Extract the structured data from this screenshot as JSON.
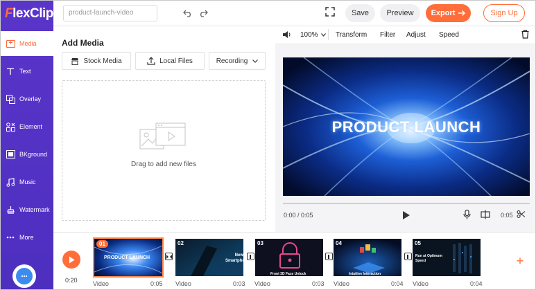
{
  "brand": {
    "logo_first": "F",
    "logo_rest": "lexClip",
    "accent": "#ff6e3a",
    "sidebar_color": "#5433c4"
  },
  "sidebar": {
    "items": [
      {
        "label": "Media",
        "icon": "media-icon",
        "active": true
      },
      {
        "label": "Text",
        "icon": "text-icon"
      },
      {
        "label": "Overlay",
        "icon": "overlay-icon"
      },
      {
        "label": "Element",
        "icon": "element-icon"
      },
      {
        "label": "BKground",
        "icon": "background-icon"
      },
      {
        "label": "Music",
        "icon": "music-icon"
      },
      {
        "label": "Watermark",
        "icon": "watermark-icon"
      },
      {
        "label": "More",
        "icon": "more-icon"
      }
    ]
  },
  "topbar": {
    "project_name": "product-launch-video",
    "save": "Save",
    "preview": "Preview",
    "export": "Export",
    "signup": "Sign Up"
  },
  "media_panel": {
    "title": "Add Media",
    "stock_media": "Stock Media",
    "local_files": "Local Files",
    "recording": "Recording",
    "drop_text": "Drag to add new files"
  },
  "preview": {
    "zoom": "100%",
    "tools": [
      "Transform",
      "Filter",
      "Adjust",
      "Speed"
    ],
    "video_title": "PRODUCT LAUNCH",
    "time": "0:00 / 0:05",
    "duration": "0:05"
  },
  "timeline": {
    "total": "0:20",
    "clips": [
      {
        "num": "01",
        "caption": "PRODUCT LAUNCH",
        "label": "Video",
        "duration": "0:05"
      },
      {
        "num": "02",
        "caption": "New Smartphone",
        "label": "Video",
        "duration": "0:03"
      },
      {
        "num": "03",
        "caption": "Front 3D Face Unlock",
        "label": "Video",
        "duration": "0:03"
      },
      {
        "num": "04",
        "caption": "Intuitive Interaction",
        "label": "Video",
        "duration": "0:04"
      },
      {
        "num": "05",
        "caption": "Run at Optimum Speed",
        "label": "Video",
        "duration": "0:04"
      }
    ]
  }
}
